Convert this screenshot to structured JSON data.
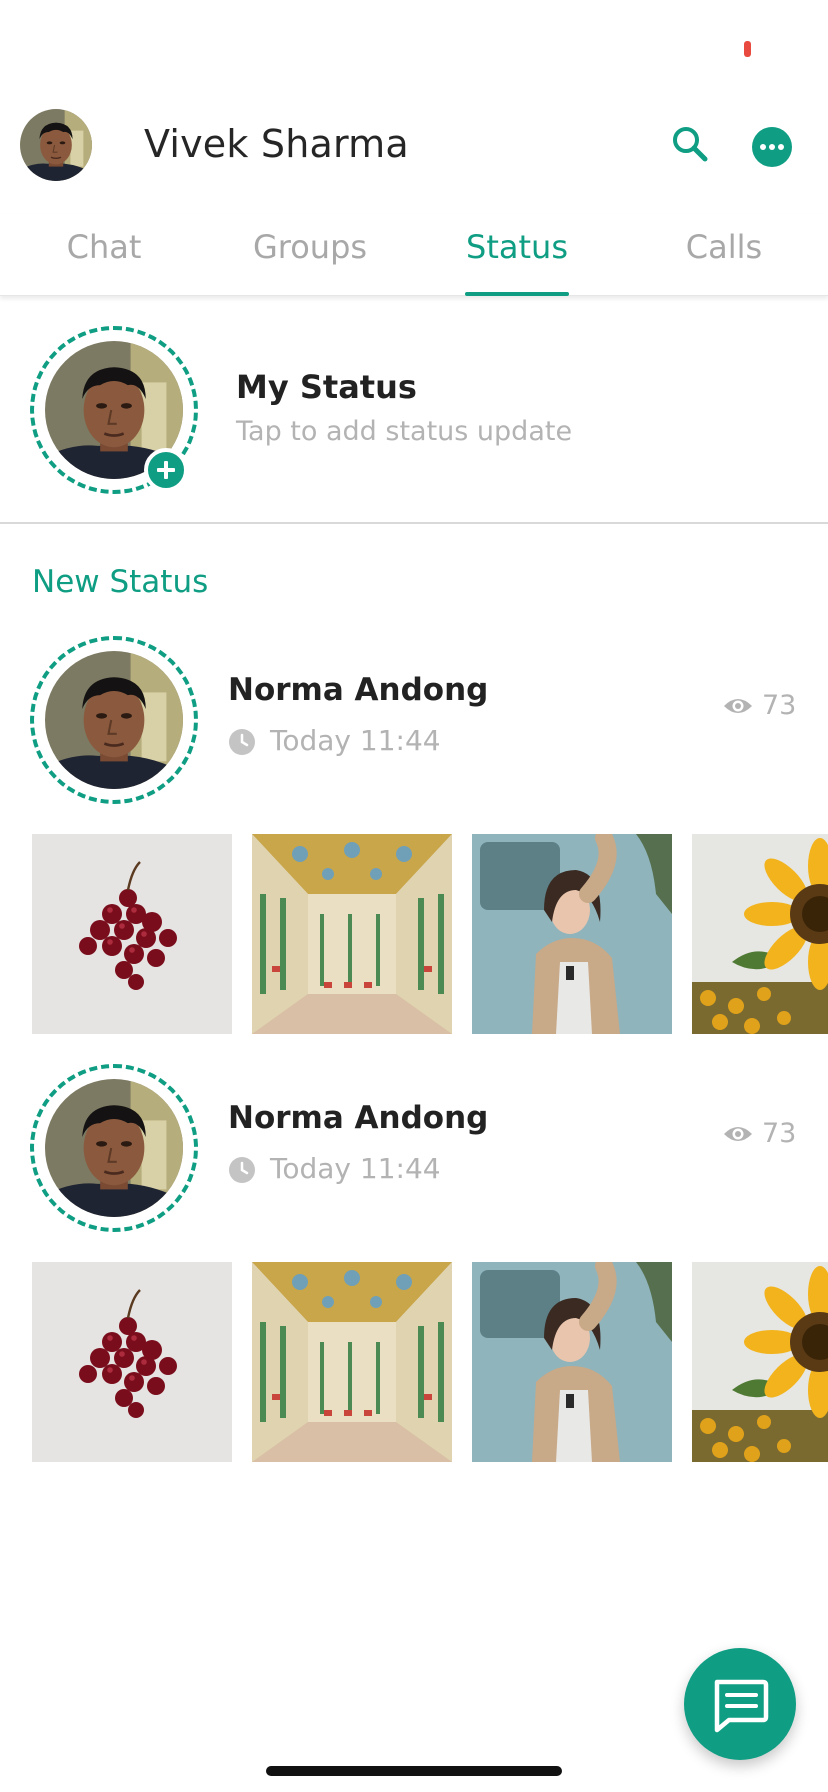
{
  "header": {
    "user_name": "Vivek Sharma"
  },
  "tabs": [
    {
      "label": "Chat",
      "active": false
    },
    {
      "label": "Groups",
      "active": false
    },
    {
      "label": "Status",
      "active": true
    },
    {
      "label": "Calls",
      "active": false
    }
  ],
  "my_status": {
    "title": "My Status",
    "subtitle": "Tap to add status update"
  },
  "section": {
    "title": "New Status"
  },
  "entries": [
    {
      "name": "Norma Andong",
      "time": "Today 11:44",
      "views": "73",
      "thumbnails": [
        "cherries",
        "palace-hall",
        "woman-by-car",
        "sunflower"
      ]
    },
    {
      "name": "Norma Andong",
      "time": "Today 11:44",
      "views": "73",
      "thumbnails": [
        "cherries",
        "palace-hall",
        "woman-by-car",
        "sunflower"
      ]
    }
  ],
  "colors": {
    "accent": "#0f9e83",
    "muted_text": "#b3b3b3",
    "recording_dot": "#e84a3f"
  },
  "icons": {
    "search": "search-icon",
    "more": "more-icon",
    "add": "plus-icon",
    "clock": "clock-icon",
    "views": "eye-icon",
    "fab": "message-icon"
  }
}
